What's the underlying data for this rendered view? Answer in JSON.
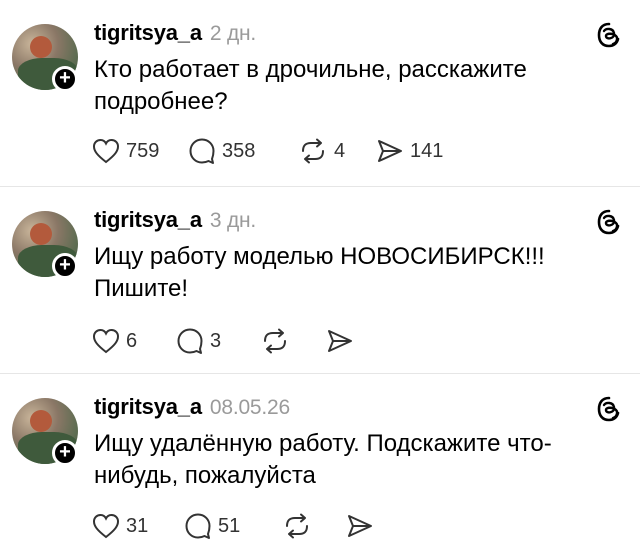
{
  "posts": [
    {
      "username": "tigritsya_a",
      "time": "2 дн.",
      "text": "Кто работает в дрочильне, расскажите подробнее?",
      "likes": "759",
      "comments": "358",
      "reposts": "4",
      "shares": "141"
    },
    {
      "username": "tigritsya_a",
      "time": "3 дн.",
      "text": "Ищу работу моделью НОВОСИБИРСК!!! Пишите!",
      "likes": "6",
      "comments": "3",
      "reposts": "",
      "shares": ""
    },
    {
      "username": "tigritsya_a",
      "time": "08.05.26",
      "text": "Ищу удалённую работу. Подскажите что-нибудь, пожалуйста",
      "likes": "31",
      "comments": "51",
      "reposts": "",
      "shares": ""
    }
  ],
  "badge_symbol": "+",
  "icons": {
    "like": "heart-icon",
    "comment": "comment-bubble-icon",
    "repost": "repost-icon",
    "share": "send-icon",
    "app": "threads-logo-icon"
  }
}
